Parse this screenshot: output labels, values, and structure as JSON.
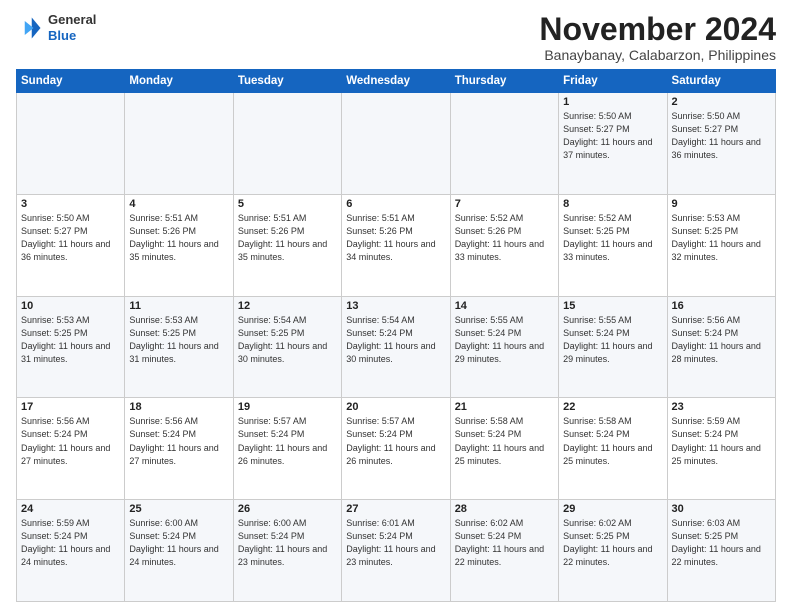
{
  "logo": {
    "line1": "General",
    "line2": "Blue"
  },
  "header": {
    "month": "November 2024",
    "location": "Banaybanay, Calabarzon, Philippines"
  },
  "days_of_week": [
    "Sunday",
    "Monday",
    "Tuesday",
    "Wednesday",
    "Thursday",
    "Friday",
    "Saturday"
  ],
  "weeks": [
    [
      {
        "day": "",
        "info": ""
      },
      {
        "day": "",
        "info": ""
      },
      {
        "day": "",
        "info": ""
      },
      {
        "day": "",
        "info": ""
      },
      {
        "day": "",
        "info": ""
      },
      {
        "day": "1",
        "info": "Sunrise: 5:50 AM\nSunset: 5:27 PM\nDaylight: 11 hours\nand 37 minutes."
      },
      {
        "day": "2",
        "info": "Sunrise: 5:50 AM\nSunset: 5:27 PM\nDaylight: 11 hours\nand 36 minutes."
      }
    ],
    [
      {
        "day": "3",
        "info": "Sunrise: 5:50 AM\nSunset: 5:27 PM\nDaylight: 11 hours\nand 36 minutes."
      },
      {
        "day": "4",
        "info": "Sunrise: 5:51 AM\nSunset: 5:26 PM\nDaylight: 11 hours\nand 35 minutes."
      },
      {
        "day": "5",
        "info": "Sunrise: 5:51 AM\nSunset: 5:26 PM\nDaylight: 11 hours\nand 35 minutes."
      },
      {
        "day": "6",
        "info": "Sunrise: 5:51 AM\nSunset: 5:26 PM\nDaylight: 11 hours\nand 34 minutes."
      },
      {
        "day": "7",
        "info": "Sunrise: 5:52 AM\nSunset: 5:26 PM\nDaylight: 11 hours\nand 33 minutes."
      },
      {
        "day": "8",
        "info": "Sunrise: 5:52 AM\nSunset: 5:25 PM\nDaylight: 11 hours\nand 33 minutes."
      },
      {
        "day": "9",
        "info": "Sunrise: 5:53 AM\nSunset: 5:25 PM\nDaylight: 11 hours\nand 32 minutes."
      }
    ],
    [
      {
        "day": "10",
        "info": "Sunrise: 5:53 AM\nSunset: 5:25 PM\nDaylight: 11 hours\nand 31 minutes."
      },
      {
        "day": "11",
        "info": "Sunrise: 5:53 AM\nSunset: 5:25 PM\nDaylight: 11 hours\nand 31 minutes."
      },
      {
        "day": "12",
        "info": "Sunrise: 5:54 AM\nSunset: 5:25 PM\nDaylight: 11 hours\nand 30 minutes."
      },
      {
        "day": "13",
        "info": "Sunrise: 5:54 AM\nSunset: 5:24 PM\nDaylight: 11 hours\nand 30 minutes."
      },
      {
        "day": "14",
        "info": "Sunrise: 5:55 AM\nSunset: 5:24 PM\nDaylight: 11 hours\nand 29 minutes."
      },
      {
        "day": "15",
        "info": "Sunrise: 5:55 AM\nSunset: 5:24 PM\nDaylight: 11 hours\nand 29 minutes."
      },
      {
        "day": "16",
        "info": "Sunrise: 5:56 AM\nSunset: 5:24 PM\nDaylight: 11 hours\nand 28 minutes."
      }
    ],
    [
      {
        "day": "17",
        "info": "Sunrise: 5:56 AM\nSunset: 5:24 PM\nDaylight: 11 hours\nand 27 minutes."
      },
      {
        "day": "18",
        "info": "Sunrise: 5:56 AM\nSunset: 5:24 PM\nDaylight: 11 hours\nand 27 minutes."
      },
      {
        "day": "19",
        "info": "Sunrise: 5:57 AM\nSunset: 5:24 PM\nDaylight: 11 hours\nand 26 minutes."
      },
      {
        "day": "20",
        "info": "Sunrise: 5:57 AM\nSunset: 5:24 PM\nDaylight: 11 hours\nand 26 minutes."
      },
      {
        "day": "21",
        "info": "Sunrise: 5:58 AM\nSunset: 5:24 PM\nDaylight: 11 hours\nand 25 minutes."
      },
      {
        "day": "22",
        "info": "Sunrise: 5:58 AM\nSunset: 5:24 PM\nDaylight: 11 hours\nand 25 minutes."
      },
      {
        "day": "23",
        "info": "Sunrise: 5:59 AM\nSunset: 5:24 PM\nDaylight: 11 hours\nand 25 minutes."
      }
    ],
    [
      {
        "day": "24",
        "info": "Sunrise: 5:59 AM\nSunset: 5:24 PM\nDaylight: 11 hours\nand 24 minutes."
      },
      {
        "day": "25",
        "info": "Sunrise: 6:00 AM\nSunset: 5:24 PM\nDaylight: 11 hours\nand 24 minutes."
      },
      {
        "day": "26",
        "info": "Sunrise: 6:00 AM\nSunset: 5:24 PM\nDaylight: 11 hours\nand 23 minutes."
      },
      {
        "day": "27",
        "info": "Sunrise: 6:01 AM\nSunset: 5:24 PM\nDaylight: 11 hours\nand 23 minutes."
      },
      {
        "day": "28",
        "info": "Sunrise: 6:02 AM\nSunset: 5:24 PM\nDaylight: 11 hours\nand 22 minutes."
      },
      {
        "day": "29",
        "info": "Sunrise: 6:02 AM\nSunset: 5:25 PM\nDaylight: 11 hours\nand 22 minutes."
      },
      {
        "day": "30",
        "info": "Sunrise: 6:03 AM\nSunset: 5:25 PM\nDaylight: 11 hours\nand 22 minutes."
      }
    ]
  ]
}
